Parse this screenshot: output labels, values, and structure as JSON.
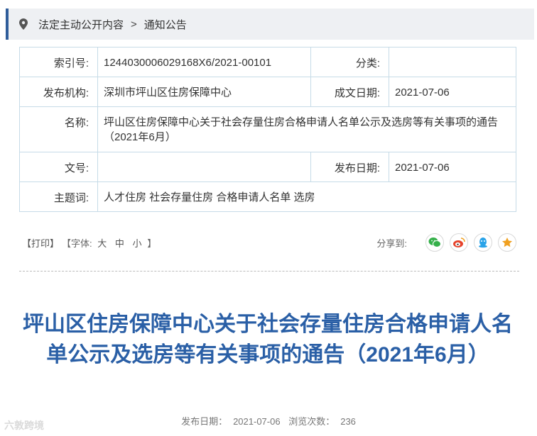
{
  "breadcrumb": {
    "icon": "location-pin-icon",
    "item1": "法定主动公开内容",
    "item2": "通知公告"
  },
  "meta": {
    "index_label": "索引号:",
    "index_value": "1244030006029168X6/2021-00101",
    "category_label": "分类:",
    "category_value": "",
    "org_label": "发布机构:",
    "org_value": "深圳市坪山区住房保障中心",
    "created_label": "成文日期:",
    "created_value": "2021-07-06",
    "name_label": "名称:",
    "name_value": "坪山区住房保障中心关于社会存量住房合格申请人名单公示及选房等有关事项的通告（2021年6月）",
    "docno_label": "文号:",
    "docno_value": "",
    "pub_label": "发布日期:",
    "pub_value": "2021-07-06",
    "topic_label": "主题词:",
    "topic_value": "人才住房 社会存量住房 合格申请人名单 选房"
  },
  "tools": {
    "print": "【打印】",
    "font_prefix": "【字体:",
    "font_big": "大",
    "font_mid": "中",
    "font_small": "小",
    "font_suffix": "】",
    "share_label": "分享到:"
  },
  "share_icons": [
    "wechat-icon",
    "weibo-icon",
    "qq-icon",
    "favorite-star-icon"
  ],
  "colors": {
    "accent": "#2f5d9a",
    "title": "#2a5fa6",
    "table_border": "#c6dbe7",
    "wechat": "#35b04a",
    "weibo": "#e6432c",
    "qq": "#2aa3e8",
    "star": "#f0a020"
  },
  "article": {
    "title": "坪山区住房保障中心关于社会存量住房合格申请人名单公示及选房等有关事项的通告（2021年6月）",
    "pub_date_label": "发布日期：",
    "pub_date": "2021-07-06",
    "views_label": "浏览次数：",
    "views": "236"
  },
  "watermark": "六敦跨境"
}
